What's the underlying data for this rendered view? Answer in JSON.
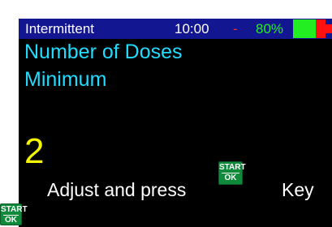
{
  "statusbar": {
    "mode": "Intermittent",
    "time": "10:00",
    "separator": "-",
    "battery_pct": "80%",
    "battery_level": 0.8,
    "colors": {
      "bar": "#121690",
      "battery_ok": "#22ee22",
      "battery_low": "#ff1111"
    }
  },
  "main": {
    "title_line1": "Number of Doses",
    "title_line2": "Minimum",
    "value": "2",
    "prompt_text": "Adjust and press",
    "prompt_suffix": "Key",
    "colors": {
      "title": "#22dcff",
      "value": "#f5f500"
    }
  },
  "key_icon": {
    "name": "start-ok-key-icon",
    "top_label": "START",
    "bottom_label": "OK",
    "color": "#0e8a3a"
  }
}
